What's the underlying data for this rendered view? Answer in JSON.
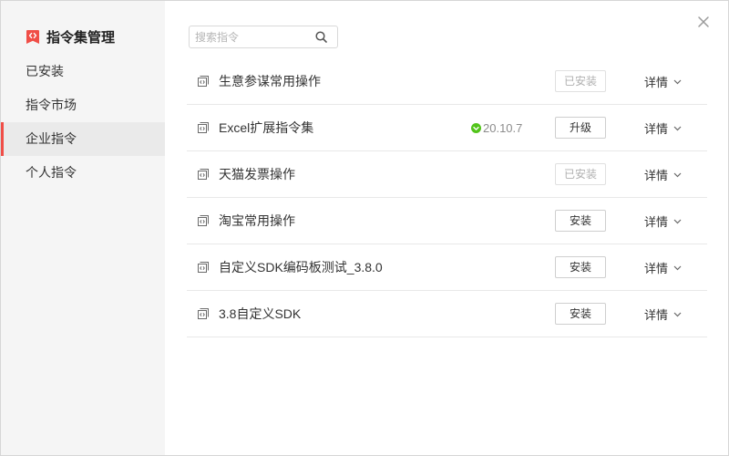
{
  "app": {
    "title": "指令集管理"
  },
  "colors": {
    "accent": "#f04e47",
    "sidebar_bg": "#f5f5f5",
    "update_green": "#52c41a"
  },
  "icons": {
    "logo": "command-set-logo-icon",
    "close": "close-icon",
    "search": "search-icon",
    "row": "command-set-icon",
    "update": "update-available-icon",
    "detail": "chevron-down-icon"
  },
  "sidebar": {
    "items": [
      {
        "label": "已安装",
        "selected": false
      },
      {
        "label": "指令市场",
        "selected": false
      },
      {
        "label": "企业指令",
        "selected": true
      },
      {
        "label": "个人指令",
        "selected": false
      }
    ]
  },
  "search": {
    "placeholder": "搜索指令",
    "value": ""
  },
  "list": {
    "rows": [
      {
        "name": "生意参谋常用操作",
        "action": "已安装",
        "disabled": true,
        "detail": "详情"
      },
      {
        "name": "Excel扩展指令集",
        "version": "20.10.7",
        "action": "升级",
        "disabled": false,
        "detail": "详情"
      },
      {
        "name": "天猫发票操作",
        "action": "已安装",
        "disabled": true,
        "detail": "详情"
      },
      {
        "name": "淘宝常用操作",
        "action": "安装",
        "disabled": false,
        "detail": "详情"
      },
      {
        "name": "自定义SDK编码板测试_3.8.0",
        "action": "安装",
        "disabled": false,
        "detail": "详情"
      },
      {
        "name": "3.8自定义SDK",
        "action": "安装",
        "disabled": false,
        "detail": "详情"
      }
    ]
  }
}
